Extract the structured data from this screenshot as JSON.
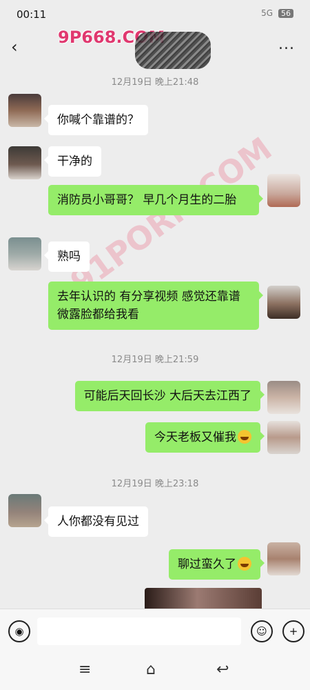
{
  "status": {
    "time": "00:11",
    "indicators": "5G",
    "battery": "56"
  },
  "header": {
    "watermark": "9P668.COM",
    "more": "..."
  },
  "watermark2": "91PORN.COM",
  "timestamps": [
    "12月19日 晚上21:48",
    "12月19日 晚上21:59",
    "12月19日 晚上23:18"
  ],
  "messages": [
    {
      "side": "in",
      "text": "你喊个靠谱的？"
    },
    {
      "side": "in",
      "text": "干净的"
    },
    {
      "side": "out",
      "text": "消防员小哥哥？ 早几个月生的二胎"
    },
    {
      "side": "in",
      "text": "熟吗"
    },
    {
      "side": "out",
      "text": "去年认识的 有分享视频 感觉还靠谱 微露脸都给我看"
    },
    {
      "side": "out",
      "text": "可能后天回长沙 大后天去江西了"
    },
    {
      "side": "out",
      "text": "今天老板又催我"
    },
    {
      "side": "in",
      "text": "人你都没有见过"
    },
    {
      "side": "out",
      "text": "聊过蛮久了"
    }
  ],
  "icons": {
    "back": "chevron-left-icon",
    "more": "more-icon",
    "voice": "voice-icon",
    "emoji": "emoji-icon",
    "plus": "plus-icon"
  },
  "colors": {
    "incoming": "#ffffff",
    "outgoing": "#95ec69",
    "background": "#ededed"
  }
}
